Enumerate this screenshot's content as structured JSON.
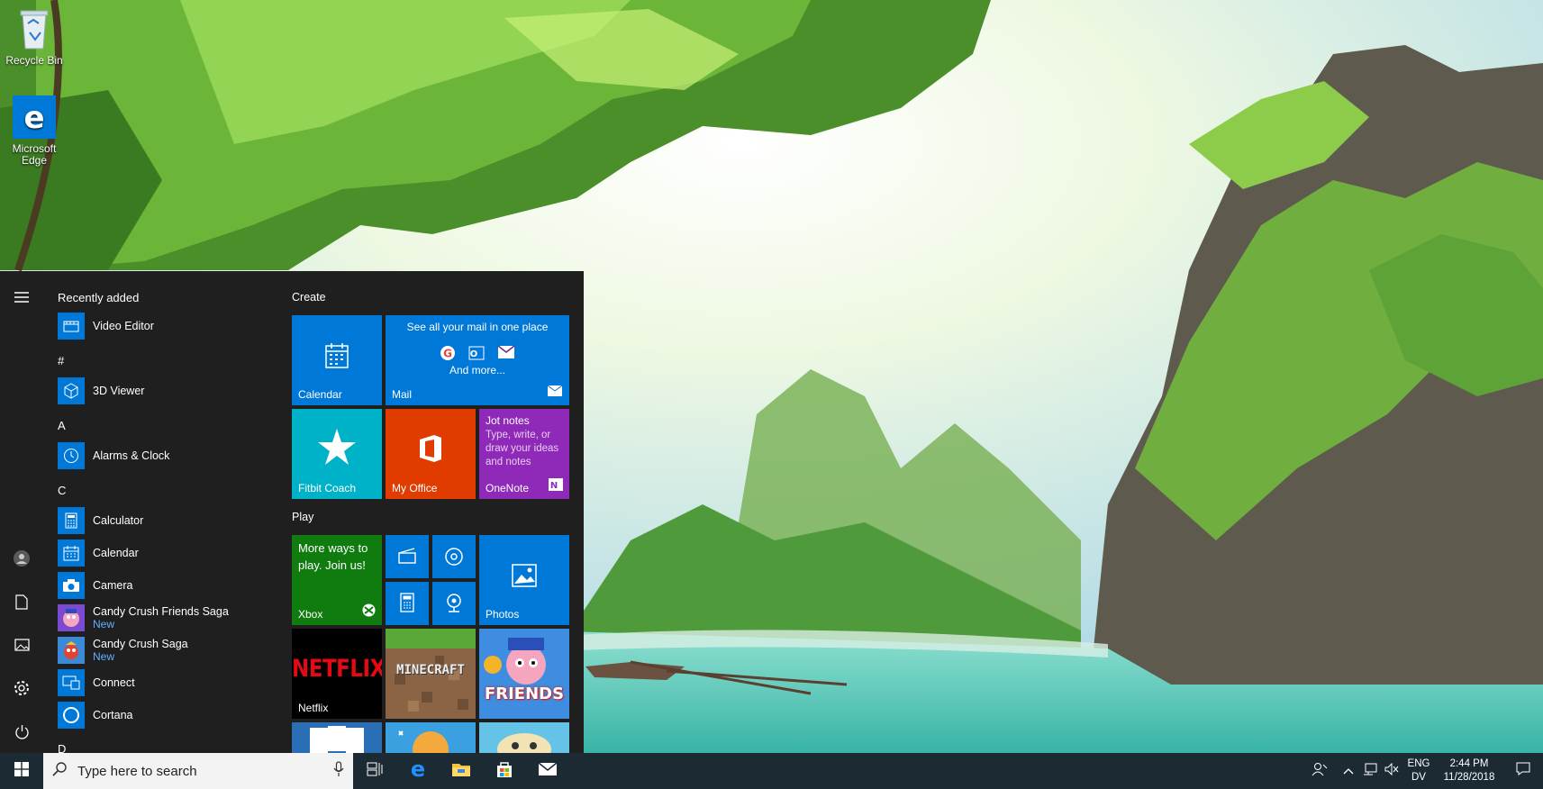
{
  "desktop": {
    "icons": [
      {
        "label": "Recycle Bin"
      },
      {
        "label": "Microsoft Edge"
      }
    ]
  },
  "start_menu": {
    "rail": {
      "items": [
        "hamburger-icon",
        "user-icon",
        "documents-icon",
        "pictures-icon",
        "settings-icon",
        "power-icon"
      ]
    },
    "app_list": {
      "recently_added_header": "Recently added",
      "sections": [
        "#",
        "A",
        "C",
        "D"
      ],
      "apps": [
        {
          "name": "Video Editor",
          "icon": "video-editor-icon"
        },
        {
          "name": "3D Viewer",
          "icon": "cube-icon"
        },
        {
          "name": "Alarms & Clock",
          "icon": "clock-icon"
        },
        {
          "name": "Calculator",
          "icon": "calculator-icon"
        },
        {
          "name": "Calendar",
          "icon": "calendar-icon"
        },
        {
          "name": "Camera",
          "icon": "camera-icon"
        },
        {
          "name": "Candy Crush Friends Saga",
          "badge": "New",
          "icon": "candy-crush-friends-icon"
        },
        {
          "name": "Candy Crush Saga",
          "badge": "New",
          "icon": "candy-crush-icon"
        },
        {
          "name": "Connect",
          "icon": "connect-icon"
        },
        {
          "name": "Cortana",
          "icon": "cortana-icon"
        }
      ]
    },
    "tiles": {
      "groups": [
        "Create",
        "Play"
      ],
      "create": {
        "calendar": "Calendar",
        "mail_headline": "See all your mail in one place",
        "mail_more": "And more...",
        "mail": "Mail",
        "fitbit": "Fitbit Coach",
        "office": "My Office",
        "onenote_title": "Jot notes",
        "onenote_body": "Type, write, or draw your ideas and notes",
        "onenote": "OneNote"
      },
      "play": {
        "xbox_promo": "More ways to play. Join us!",
        "xbox": "Xbox",
        "photos": "Photos",
        "netflix_logo": "NETFLIX",
        "netflix": "Netflix",
        "minecraft_logo": "MINECRAFT",
        "friends_logo": "FRIENDS"
      }
    },
    "colors": {
      "accent": "#0078d7",
      "teal": "#00b2c8",
      "office": "#e03c00",
      "onenote": "#8f2ab8",
      "xbox": "#107c10",
      "netflix_bg": "#000000",
      "netflix_red": "#e50914"
    }
  },
  "taskbar": {
    "search_placeholder": "Type here to search",
    "pinned": [
      "task-view-icon",
      "edge-icon",
      "file-explorer-icon",
      "store-icon",
      "mail-icon"
    ],
    "language": {
      "code": "ENG",
      "layout": "DV"
    },
    "time": "2:44 PM",
    "date": "11/28/2018"
  }
}
